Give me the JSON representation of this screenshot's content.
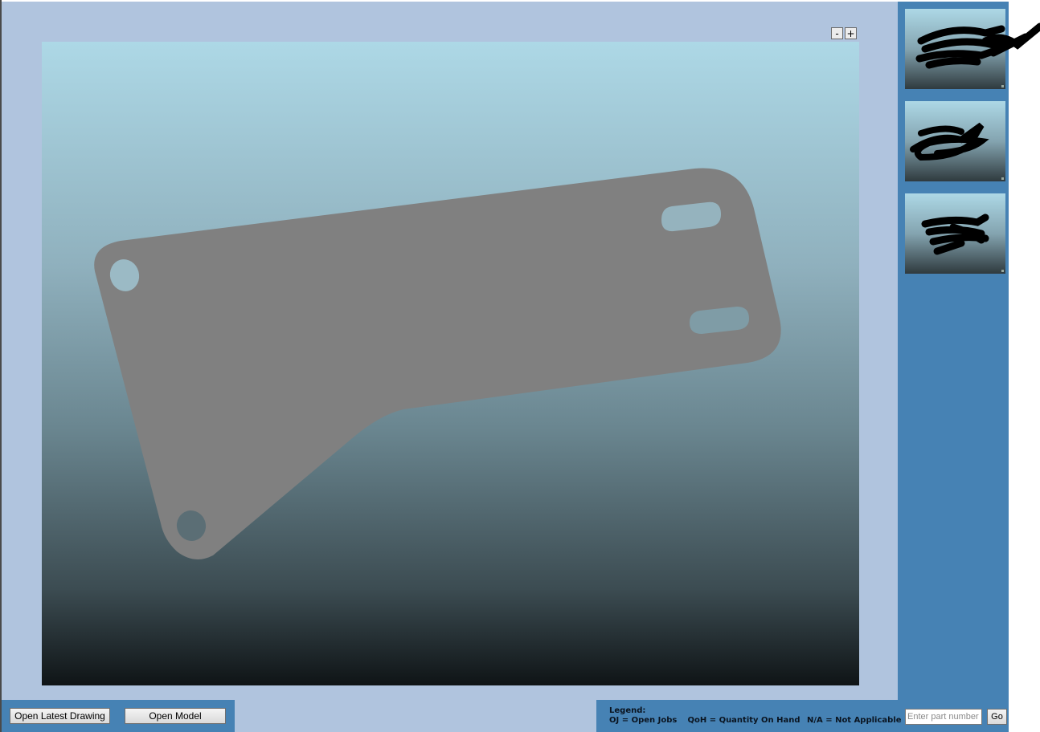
{
  "viewer": {
    "zoom_out_label": "-",
    "zoom_in_label": "+"
  },
  "thumbnails": [
    {
      "name": "view-thumbnail-1"
    },
    {
      "name": "view-thumbnail-2"
    },
    {
      "name": "view-thumbnail-3"
    }
  ],
  "actions": {
    "open_latest_drawing": "Open Latest Drawing",
    "open_model": "Open Model"
  },
  "legend": {
    "title": "Legend:",
    "oj": "OJ = Open Jobs",
    "qoh": "QoH = Quantity On Hand",
    "na": "N/A = Not Applicable"
  },
  "search": {
    "placeholder": "Enter part number",
    "value": "",
    "go_label": "Go"
  },
  "colors": {
    "panel_bg": "#b0c4de",
    "sidebar_bg": "#4682b4",
    "part_fill": "#808080",
    "viewport_top": "#add8e6",
    "viewport_bottom": "#0f1416"
  }
}
